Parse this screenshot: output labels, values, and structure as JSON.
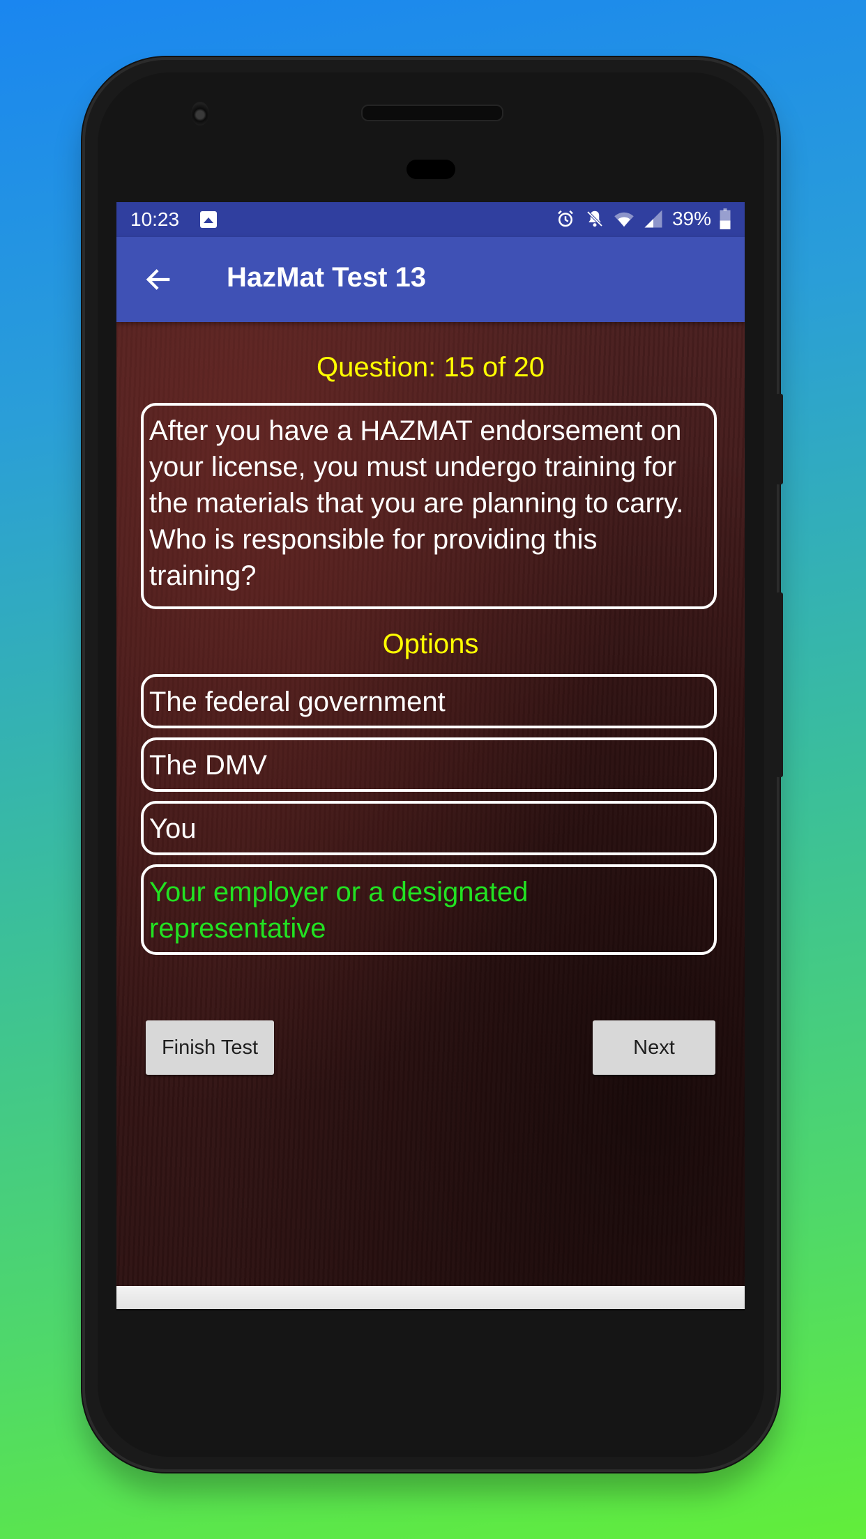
{
  "status_bar": {
    "time": "10:23",
    "battery": "39%",
    "icons": [
      "image-icon",
      "alarm-icon",
      "notifications-off-icon",
      "wifi-icon",
      "signal-icon",
      "battery-icon"
    ]
  },
  "app_bar": {
    "title": "HazMat Test 13",
    "back_icon": "arrow-back-icon"
  },
  "quiz": {
    "counter": "Question: 15 of 20",
    "current": 15,
    "total": 20,
    "question": "After you have a HAZMAT endorsement on your license, you must undergo training for the materials that you are planning to carry. Who is responsible for providing this training?",
    "options_label": "Options",
    "options": [
      {
        "text": "The federal government",
        "correct": false
      },
      {
        "text": "The DMV",
        "correct": false
      },
      {
        "text": "You",
        "correct": false
      },
      {
        "text": "Your employer or a designated representative",
        "correct": true
      }
    ],
    "correct_color": "#22e222",
    "highlight_color": "#ffff00"
  },
  "buttons": {
    "finish": "Finish Test",
    "next": "Next"
  },
  "colors": {
    "status_bar": "#303f9f",
    "app_bar": "#3f51b5"
  }
}
